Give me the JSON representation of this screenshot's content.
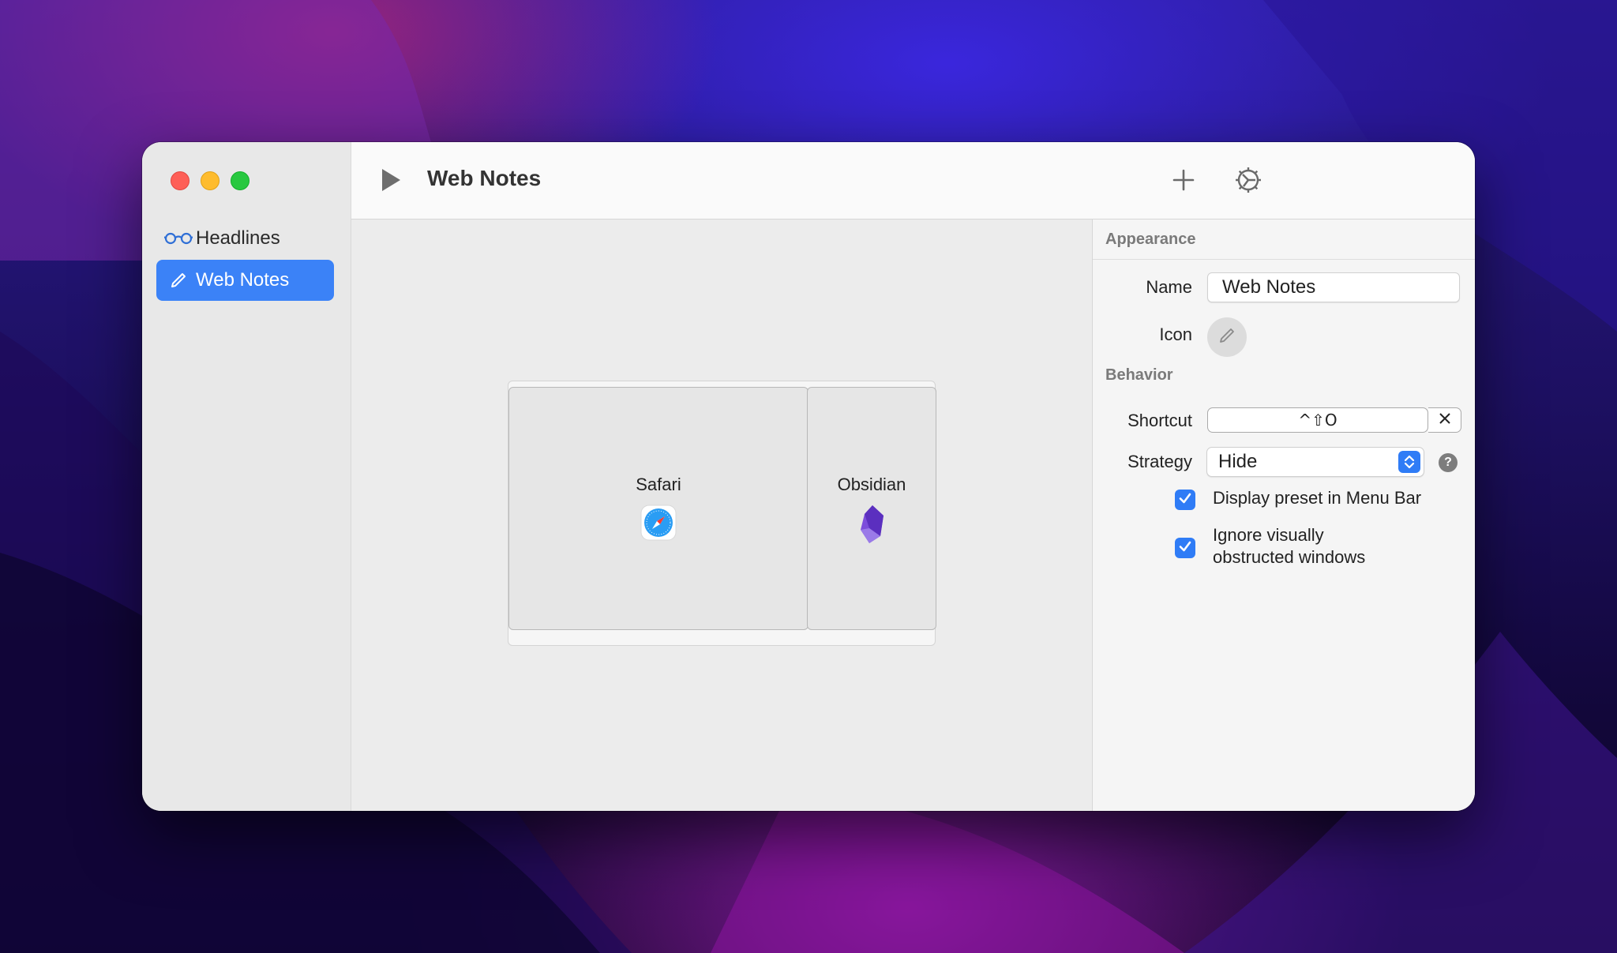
{
  "window": {
    "title": "Web Notes"
  },
  "sidebar": {
    "items": [
      {
        "label": "Headlines",
        "icon": "glasses-icon",
        "selected": false
      },
      {
        "label": "Web Notes",
        "icon": "pencil-icon",
        "selected": true
      }
    ]
  },
  "toolbar": {
    "title": "Web Notes",
    "play_icon": "play-icon",
    "add_icon": "plus-icon",
    "settings_icon": "gear-icon"
  },
  "layout_preview": {
    "apps": [
      {
        "name": "Safari",
        "icon": "safari-icon"
      },
      {
        "name": "Obsidian",
        "icon": "obsidian-icon"
      }
    ]
  },
  "inspector": {
    "appearance": {
      "heading": "Appearance",
      "name_label": "Name",
      "name_value": "Web Notes",
      "icon_label": "Icon"
    },
    "behavior": {
      "heading": "Behavior",
      "shortcut_label": "Shortcut",
      "shortcut_value": "^⇧O",
      "strategy_label": "Strategy",
      "strategy_value": "Hide",
      "help_glyph": "?",
      "checkboxes": [
        {
          "label": "Display preset in Menu Bar",
          "checked": true
        },
        {
          "label_line1": "Ignore visually",
          "label_line2": "obstructed windows",
          "checked": true
        }
      ]
    }
  },
  "colors": {
    "accent": "#3b82f7",
    "traffic_close": "#fe5f57",
    "traffic_minimize": "#febc2e",
    "traffic_zoom": "#28c840"
  }
}
